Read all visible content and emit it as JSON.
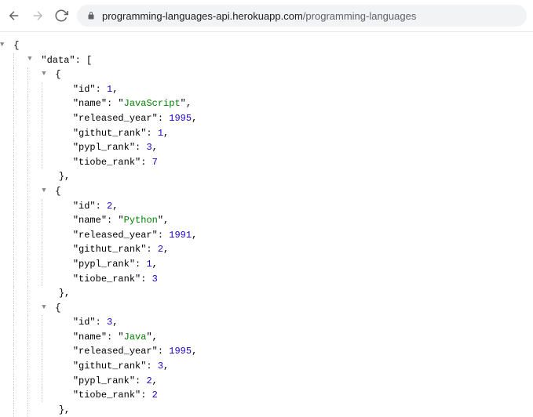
{
  "toolbar": {
    "url_domain": "programming-languages-api.herokuapp.com",
    "url_path": "/programming-languages"
  },
  "json": {
    "root_key": "data",
    "items": [
      {
        "id": {
          "key": "id",
          "value": 1
        },
        "name": {
          "key": "name",
          "value": "JavaScript"
        },
        "released_year": {
          "key": "released_year",
          "value": 1995
        },
        "githut_rank": {
          "key": "githut_rank",
          "value": 1
        },
        "pypl_rank": {
          "key": "pypl_rank",
          "value": 3
        },
        "tiobe_rank": {
          "key": "tiobe_rank",
          "value": 7
        }
      },
      {
        "id": {
          "key": "id",
          "value": 2
        },
        "name": {
          "key": "name",
          "value": "Python"
        },
        "released_year": {
          "key": "released_year",
          "value": 1991
        },
        "githut_rank": {
          "key": "githut_rank",
          "value": 2
        },
        "pypl_rank": {
          "key": "pypl_rank",
          "value": 1
        },
        "tiobe_rank": {
          "key": "tiobe_rank",
          "value": 3
        }
      },
      {
        "id": {
          "key": "id",
          "value": 3
        },
        "name": {
          "key": "name",
          "value": "Java"
        },
        "released_year": {
          "key": "released_year",
          "value": 1995
        },
        "githut_rank": {
          "key": "githut_rank",
          "value": 3
        },
        "pypl_rank": {
          "key": "pypl_rank",
          "value": 2
        },
        "tiobe_rank": {
          "key": "tiobe_rank",
          "value": 2
        }
      }
    ]
  }
}
